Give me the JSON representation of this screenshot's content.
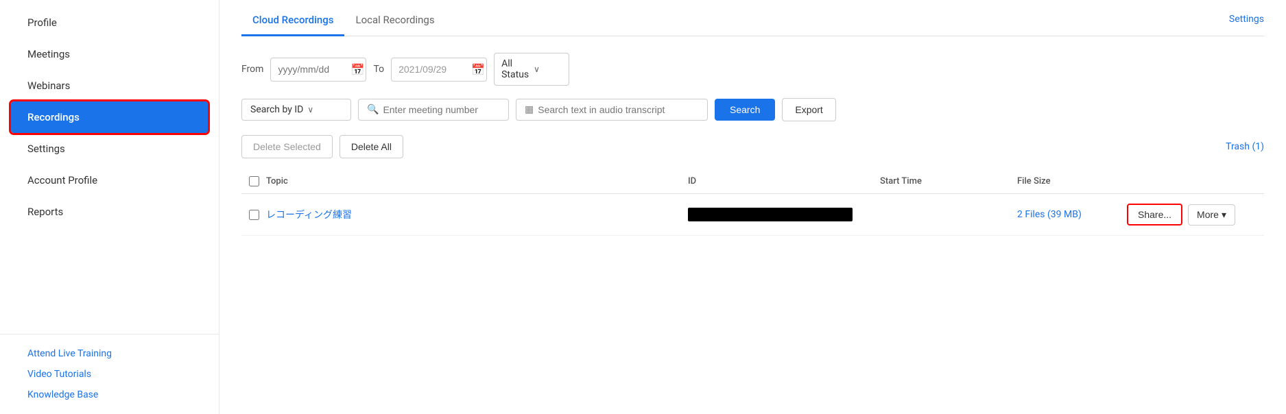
{
  "sidebar": {
    "items": [
      {
        "label": "Profile",
        "id": "profile",
        "active": false
      },
      {
        "label": "Meetings",
        "id": "meetings",
        "active": false
      },
      {
        "label": "Webinars",
        "id": "webinars",
        "active": false
      },
      {
        "label": "Recordings",
        "id": "recordings",
        "active": true
      },
      {
        "label": "Settings",
        "id": "settings",
        "active": false
      },
      {
        "label": "Account Profile",
        "id": "account-profile",
        "active": false
      },
      {
        "label": "Reports",
        "id": "reports",
        "active": false
      }
    ],
    "footer_links": [
      {
        "label": "Attend Live Training",
        "id": "live-training"
      },
      {
        "label": "Video Tutorials",
        "id": "video-tutorials"
      },
      {
        "label": "Knowledge Base",
        "id": "knowledge-base"
      }
    ]
  },
  "tabs": [
    {
      "label": "Cloud Recordings",
      "active": true
    },
    {
      "label": "Local Recordings",
      "active": false
    }
  ],
  "settings_label": "Settings",
  "filters": {
    "from_label": "From",
    "from_placeholder": "yyyy/mm/dd",
    "to_label": "To",
    "to_value": "2021/09/29",
    "status_label": "All Status",
    "status_chevron": "∨"
  },
  "search": {
    "by_label": "Search by ID",
    "by_chevron": "∨",
    "meeting_number_placeholder": "Enter meeting number",
    "transcript_placeholder": "Search text in audio transcript",
    "search_icon": "🔍",
    "transcript_icon": "▦",
    "search_button": "Search",
    "export_button": "Export"
  },
  "actions": {
    "delete_selected": "Delete Selected",
    "delete_all": "Delete All",
    "trash_label": "Trash (1)"
  },
  "table": {
    "columns": [
      "",
      "Topic",
      "ID",
      "Start Time",
      "File Size",
      ""
    ],
    "rows": [
      {
        "topic": "レコーディング練習",
        "id_redacted": true,
        "start_time": "",
        "file_size": "2 Files (39 MB)",
        "share_button": "Share...",
        "more_button": "More"
      }
    ]
  }
}
